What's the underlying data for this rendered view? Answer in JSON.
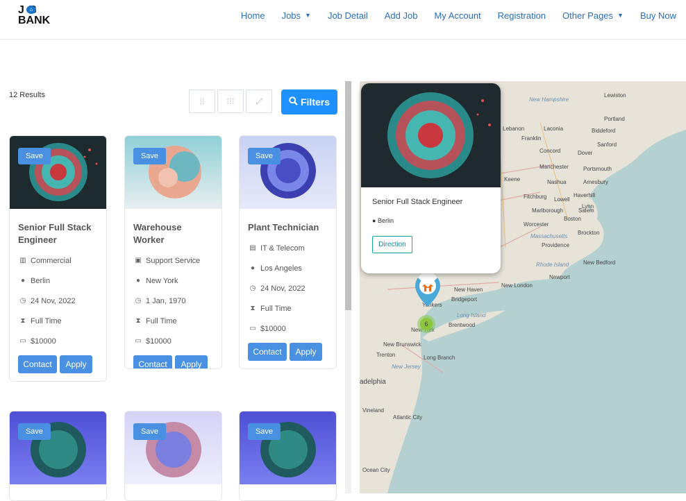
{
  "logo": {
    "line1": "J B",
    "line2": "BANK"
  },
  "nav": [
    {
      "label": "Home",
      "dropdown": false
    },
    {
      "label": "Jobs",
      "dropdown": true
    },
    {
      "label": "Job Detail",
      "dropdown": false
    },
    {
      "label": "Add Job",
      "dropdown": false
    },
    {
      "label": "My Account",
      "dropdown": false
    },
    {
      "label": "Registration",
      "dropdown": false
    },
    {
      "label": "Other Pages",
      "dropdown": true
    },
    {
      "label": "Buy Now",
      "dropdown": false
    }
  ],
  "results_count": "12 Results",
  "filters_label": "Filters",
  "cards": [
    {
      "save": "Save",
      "title": "Senior Full Stack Engineer",
      "category": "Commercial",
      "location": "Berlin",
      "date": "24 Nov, 2022",
      "type": "Full Time",
      "salary": "$10000",
      "contact": "Contact",
      "apply": "Apply",
      "theme": "dark"
    },
    {
      "save": "Save",
      "title": "Warehouse Worker",
      "category": "Support Service",
      "location": "New York",
      "date": "1 Jan, 1970",
      "type": "Full Time",
      "salary": "$10000",
      "contact": "Contact",
      "apply": "Apply",
      "theme": "light-blue"
    },
    {
      "save": "Save",
      "title": "Plant Technician",
      "category": "IT & Telecom",
      "location": "Los Angeles",
      "date": "24 Nov, 2022",
      "type": "Full Time",
      "salary": "$10000",
      "contact": "Contact",
      "apply": "Apply",
      "theme": "purple-blue"
    },
    {
      "save": "Save",
      "theme": "indigo"
    },
    {
      "save": "Save",
      "theme": "lavender"
    },
    {
      "save": "Save",
      "theme": "indigo"
    }
  ],
  "popup": {
    "title": "Senior Full Stack Engineer",
    "location": "Berlin",
    "direction": "Direction"
  },
  "zoom": {
    "in": "+",
    "out": "−"
  },
  "cluster_count": "6",
  "map_labels": [
    "Lewiston",
    "New Hampshire",
    "Portland",
    "Lebanon",
    "Laconia",
    "Biddeford",
    "Franklin",
    "Sanford",
    "Concord",
    "Dover",
    "Manchester",
    "Portsmouth",
    "Keene",
    "Nashua",
    "Amesbury",
    "Fitchburg",
    "Lowell",
    "Haverhill",
    "Marlborough",
    "Salem",
    "Lynn",
    "Worcester",
    "Boston",
    "Massachusetts",
    "Brockton",
    "Providence",
    "Rhode Island",
    "New Bedford",
    "Newport",
    "New London",
    "New Haven",
    "Bridgeport",
    "Long Island",
    "Brentwood",
    "Yonkers",
    "New York",
    "New Brunswick",
    "Trenton",
    "Long Branch",
    "New Jersey",
    "adelphia",
    "Vineland",
    "Atlantic City",
    "Ocean City"
  ],
  "colors": {
    "accent": "#4a90e2",
    "filters": "#1e90ff",
    "nav": "#2a6ebb",
    "map_water": "#b5d0d0"
  }
}
